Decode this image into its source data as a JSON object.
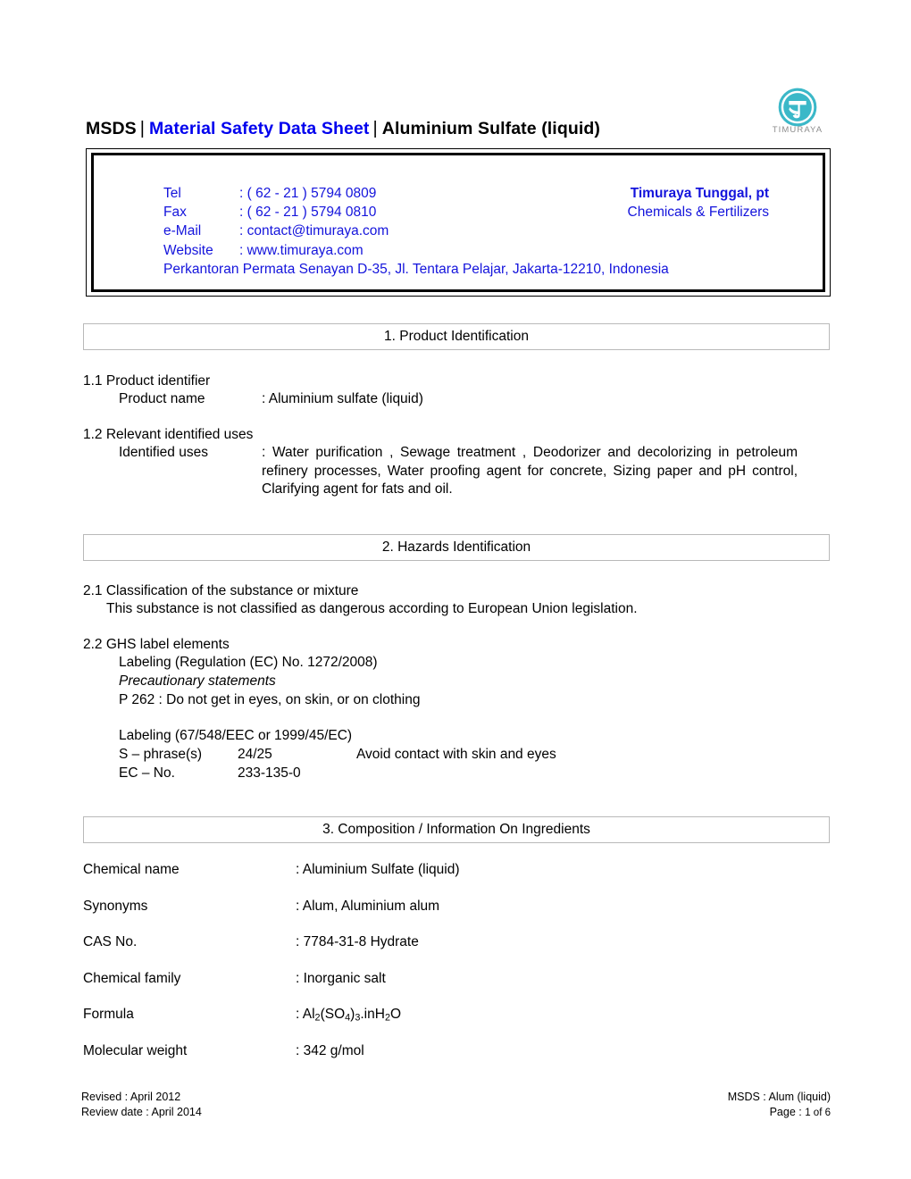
{
  "document": {
    "title_prefix": "MSDS",
    "title_main": "Material Safety Data Sheet",
    "title_product": "Aluminium Sulfate (liquid)",
    "separator": "|"
  },
  "logo": {
    "wordmark": "TIMURAYA",
    "mark_icon": "timuraya-circle-t-logo",
    "color": "#3bb8c8"
  },
  "contact": {
    "rows": [
      {
        "label": "Tel",
        "value": ": ( 62 - 21 ) 5794 0809"
      },
      {
        "label": "Fax",
        "value": ": ( 62 - 21 ) 5794 0810"
      },
      {
        "label": "e-Mail",
        "value": ": contact@timuraya.com"
      },
      {
        "label": "Website",
        "value": ": www.timuraya.com"
      }
    ],
    "address": "Perkantoran Permata Senayan D-35, Jl. Tentara Pelajar, Jakarta-12210, Indonesia",
    "company": "Timuraya Tunggal, pt",
    "tagline": "Chemicals & Fertilizers",
    "text_color": "#1414DC"
  },
  "sections": {
    "s1": {
      "heading": "1. Product Identification",
      "sub1_title": "1.1 Product identifier",
      "product_name_label": "Product name",
      "product_name_value": ": Aluminium sulfate (liquid)",
      "sub2_title": "1.2 Relevant identified uses",
      "identified_uses_label": "Identified uses",
      "identified_uses_value": ": Water purification , Sewage treatment , Deodorizer and decolorizing in petroleum refinery processes, Water proofing agent for concrete, Sizing paper and pH control, Clarifying agent for fats and oil."
    },
    "s2": {
      "heading": "2. Hazards Identification",
      "sub1_title": "2.1 Classification of the substance or mixture",
      "sub1_body": "This substance is not classified as dangerous according to European Union legislation.",
      "sub2_title": "2.2 GHS label elements",
      "labeling_1272": "Labeling (Regulation (EC) No. 1272/2008)",
      "precautionary_heading": "Precautionary statements",
      "p262": "P 262   : Do not get in eyes, on skin, or on clothing",
      "labeling_67548": "Labeling (67/548/EEC or 1999/45/EC)",
      "s_phrase_label": "S – phrase(s)",
      "s_phrase_code": "24/25",
      "s_phrase_text": "Avoid contact with skin and eyes",
      "ec_no_label": "EC – No.",
      "ec_no_value": "233-135-0"
    },
    "s3": {
      "heading": "3. Composition / Information On Ingredients",
      "rows": [
        {
          "name": "Chemical name",
          "value": ": Aluminium Sulfate (liquid)"
        },
        {
          "name": "Synonyms",
          "value": ": Alum, Aluminium alum"
        },
        {
          "name": "CAS No.",
          "value": ": 7784-31-8 Hydrate"
        },
        {
          "name": "Chemical family",
          "value": ": Inorganic salt"
        },
        {
          "name": "Formula",
          "value": ": Al2(SO4)3.inH2O"
        },
        {
          "name": "Molecular weight",
          "value": ": 342 g/mol"
        }
      ]
    }
  },
  "footer": {
    "revised": "Revised : April 2012",
    "review_date": "Review date : April 2014",
    "msds_ref": "MSDS : Alum (liquid)",
    "page_label": "Page : ",
    "page_current": "1",
    "page_of": " of ",
    "page_total": "6"
  }
}
